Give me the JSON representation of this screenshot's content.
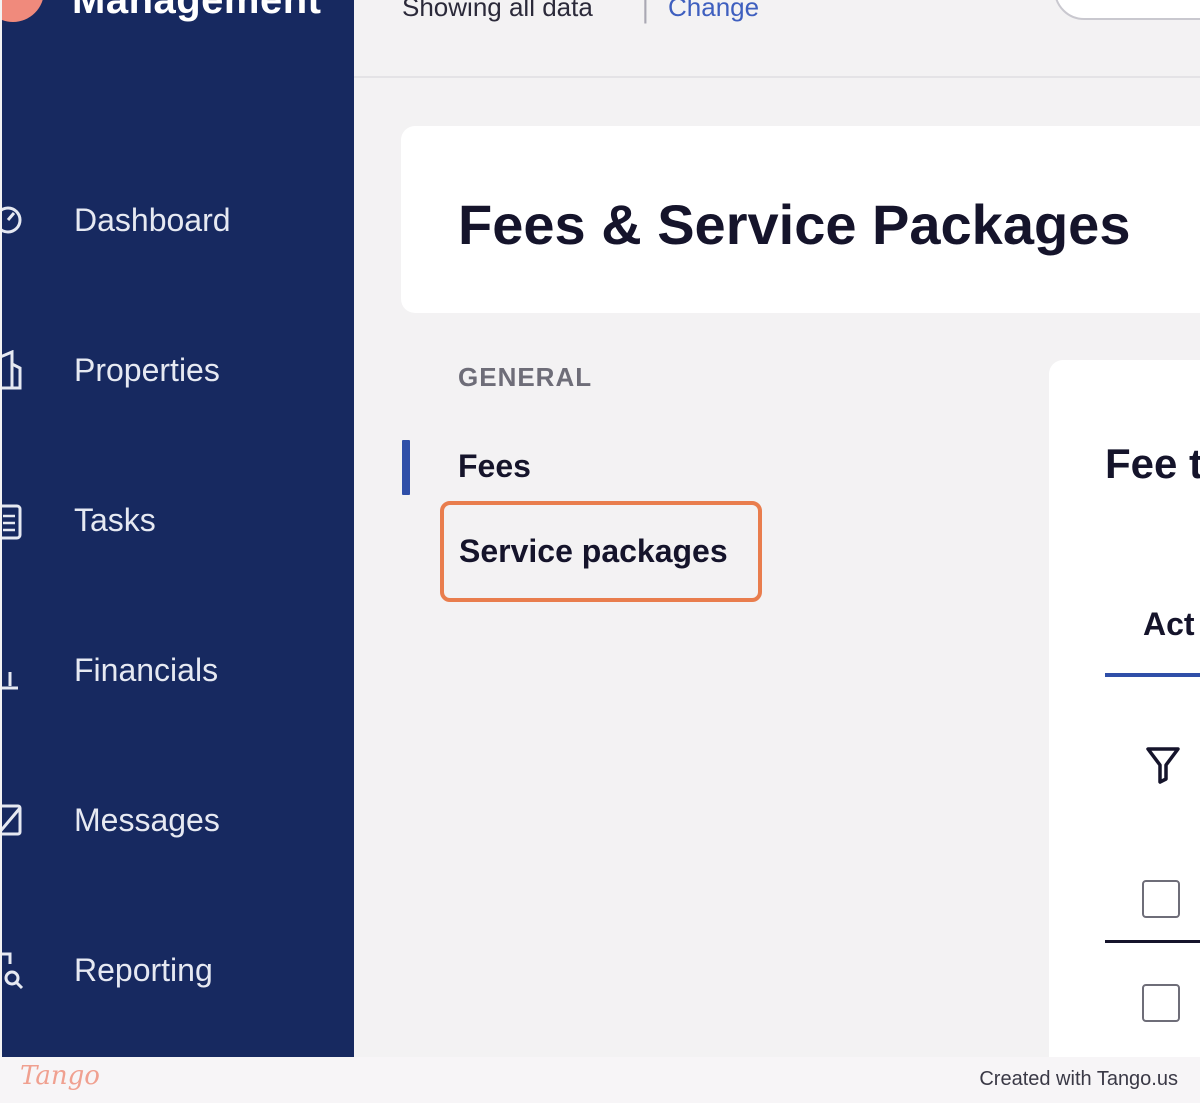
{
  "sidebar": {
    "brand": "Management",
    "items": [
      {
        "label": "Dashboard",
        "icon": "dashboard-icon"
      },
      {
        "label": "Properties",
        "icon": "building-icon"
      },
      {
        "label": "Tasks",
        "icon": "clipboard-icon"
      },
      {
        "label": "Financials",
        "icon": "bank-icon"
      },
      {
        "label": "Messages",
        "icon": "message-icon"
      },
      {
        "label": "Reporting",
        "icon": "report-search-icon"
      }
    ]
  },
  "topbar": {
    "showing": "Showing all data",
    "separator": "|",
    "change_label": "Change"
  },
  "page": {
    "title": "Fees & Service Packages"
  },
  "subnav": {
    "heading": "GENERAL",
    "fees_label": "Fees",
    "service_packages_label": "Service packages"
  },
  "content": {
    "title": "Fee t",
    "active_tab": "Act"
  },
  "footer": {
    "logo": "Tango",
    "credit": "Created with Tango.us"
  },
  "colors": {
    "sidebar_bg": "#172960",
    "accent": "#2f4fa8",
    "highlight": "#e97d4d",
    "link": "#3e5fbf"
  }
}
